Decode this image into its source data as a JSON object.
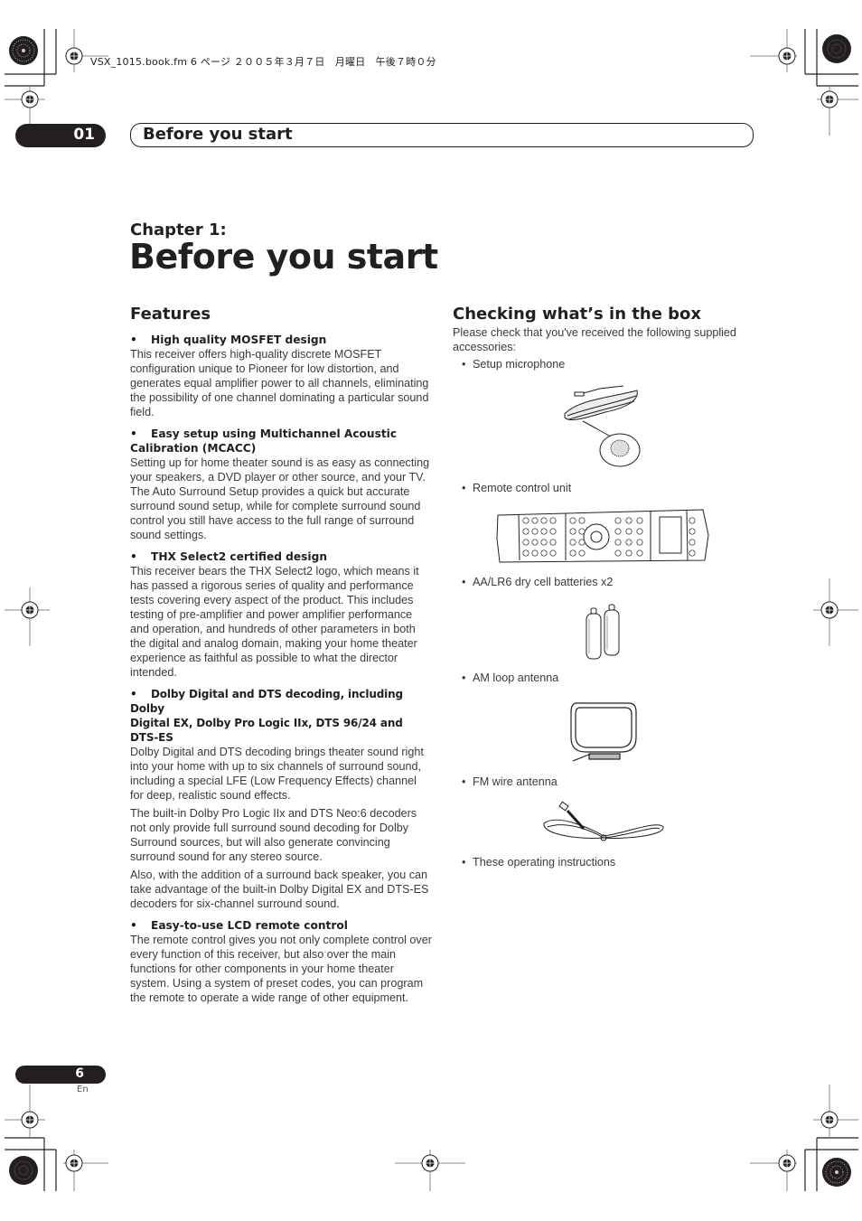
{
  "file_header": "VSX_1015.book.fm  6 ページ  ２００５年３月７日　月曜日　午後７時０分",
  "chapter_tab": {
    "number": "01",
    "title": "Before you start"
  },
  "chapter": {
    "label": "Chapter 1:",
    "title": "Before you start"
  },
  "features": {
    "heading": "Features",
    "items": [
      {
        "title": "High quality MOSFET design",
        "title_cont": "",
        "paragraphs": [
          "This receiver offers high-quality discrete MOSFET configuration unique to Pioneer for low distortion, and generates equal amplifier power to all channels, eliminating the possibility of one channel dominating a particular sound field."
        ]
      },
      {
        "title": "Easy setup using Multichannel Acoustic",
        "title_cont": "Calibration (MCACC)",
        "paragraphs": [
          "Setting up for home theater sound is as easy as connecting your speakers, a DVD player or other source, and your TV. The Auto Surround Setup provides a quick but accurate surround sound setup, while for complete surround sound control you still have access to the full range of surround sound settings."
        ]
      },
      {
        "title": "THX Select2 certified design",
        "title_cont": "",
        "paragraphs": [
          "This receiver bears the THX Select2 logo, which means it has passed a rigorous series of quality and performance tests covering every aspect of the product. This includes testing of pre-amplifier and power amplifier performance and operation, and hundreds of other parameters in both the digital and analog domain, making your home theater experience as faithful as possible to what the director intended."
        ]
      },
      {
        "title": "Dolby Digital and DTS decoding, including Dolby",
        "title_cont": "Digital EX, Dolby Pro Logic IIx, DTS 96/24 and DTS-ES",
        "paragraphs": [
          "Dolby Digital and DTS decoding brings theater sound right into your home with up to six channels of surround sound, including a special LFE (Low Frequency Effects) channel for deep, realistic sound effects.",
          "The built-in Dolby Pro Logic IIx and DTS Neo:6 decoders not only provide full surround sound decoding for Dolby Surround sources, but will also generate convincing surround sound for any stereo source.",
          "Also, with the addition of a surround back speaker, you can take advantage of the built-in Dolby Digital EX and DTS-ES decoders for six-channel surround sound."
        ]
      },
      {
        "title": "Easy-to-use LCD remote control",
        "title_cont": "",
        "paragraphs": [
          "The remote control gives you not only complete control over every function of this receiver, but also over the main functions for other components in your home theater system. Using a system of preset codes, you can program the remote to operate a wide range of other equipment."
        ]
      }
    ]
  },
  "box": {
    "heading": "Checking what’s in the box",
    "intro": "Please check that you've received the following supplied accessories:",
    "items": [
      {
        "label": "Setup microphone",
        "illustration": "microphone-illustration"
      },
      {
        "label": "Remote control unit",
        "illustration": "remote-control-illustration"
      },
      {
        "label": "AA/LR6 dry cell batteries x2",
        "illustration": "batteries-illustration"
      },
      {
        "label": "AM loop antenna",
        "illustration": "am-antenna-illustration"
      },
      {
        "label": "FM wire antenna",
        "illustration": "fm-antenna-illustration"
      },
      {
        "label": "These operating instructions",
        "illustration": ""
      }
    ],
    "bullet": "•"
  },
  "feature_bullet": "•",
  "footer": {
    "page_number": "6",
    "language": "En"
  }
}
